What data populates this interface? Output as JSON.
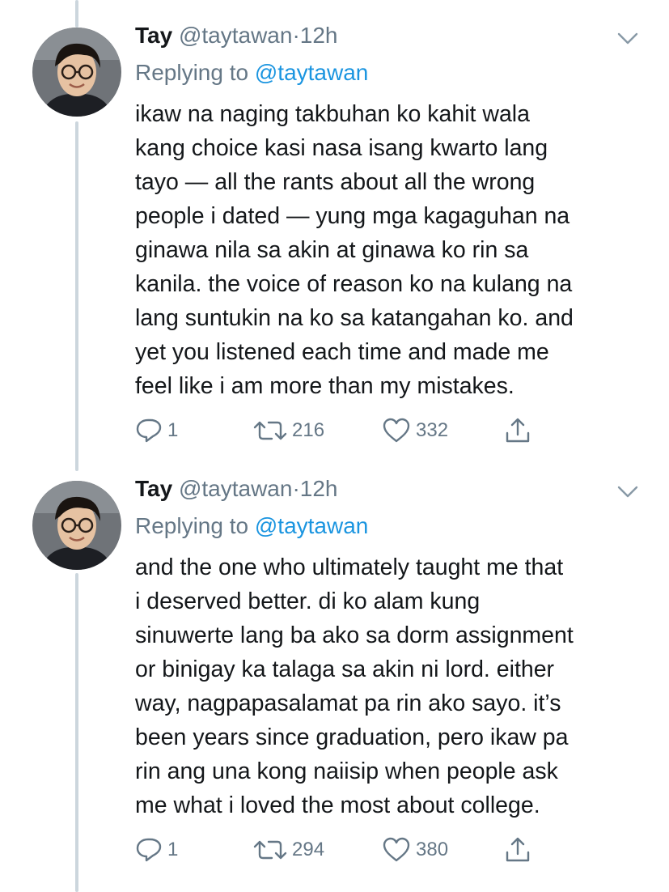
{
  "tweets": [
    {
      "name": "Tay",
      "handle": "@taytawan",
      "separator": "·",
      "time": "12h",
      "replying_prefix": "Replying to",
      "replying_to": "@taytawan",
      "lines": [
        "ikaw na naging takbuhan ko kahit wala",
        "kang choice kasi nasa isang kwarto lang",
        "tayo — all the rants about all the wrong",
        "people i dated — yung mga kagaguhan na",
        "ginawa nila sa akin at ginawa ko rin sa",
        "kanila. the voice of reason ko na kulang na",
        "lang suntukin na ko sa katangahan ko. and",
        "yet you listened each time and made me",
        "feel like i am more than my mistakes."
      ],
      "replies": "1",
      "retweets": "216",
      "likes": "332"
    },
    {
      "name": "Tay",
      "handle": "@taytawan",
      "separator": "·",
      "time": "12h",
      "replying_prefix": "Replying to",
      "replying_to": "@taytawan",
      "lines": [
        "and the one who ultimately taught me that",
        "i deserved better. di ko alam kung",
        "sinuwerte lang ba ako sa dorm assignment",
        "or binigay ka talaga sa akin ni lord. either",
        "way, nagpapasalamat pa rin ako sayo. it’s",
        "been years since graduation, pero ikaw pa",
        "rin ang una kong naiisip when people ask",
        "me what i loved the most about college."
      ],
      "replies": "1",
      "retweets": "294",
      "likes": "380"
    }
  ],
  "icons": {
    "reply": "reply-icon",
    "retweet": "retweet-icon",
    "like": "heart-icon",
    "share": "share-icon",
    "more": "chevron-down-icon"
  },
  "colors": {
    "text": "#14171a",
    "secondary": "#657786",
    "link": "#1b95e0",
    "thread_line": "#ccd6dd"
  }
}
